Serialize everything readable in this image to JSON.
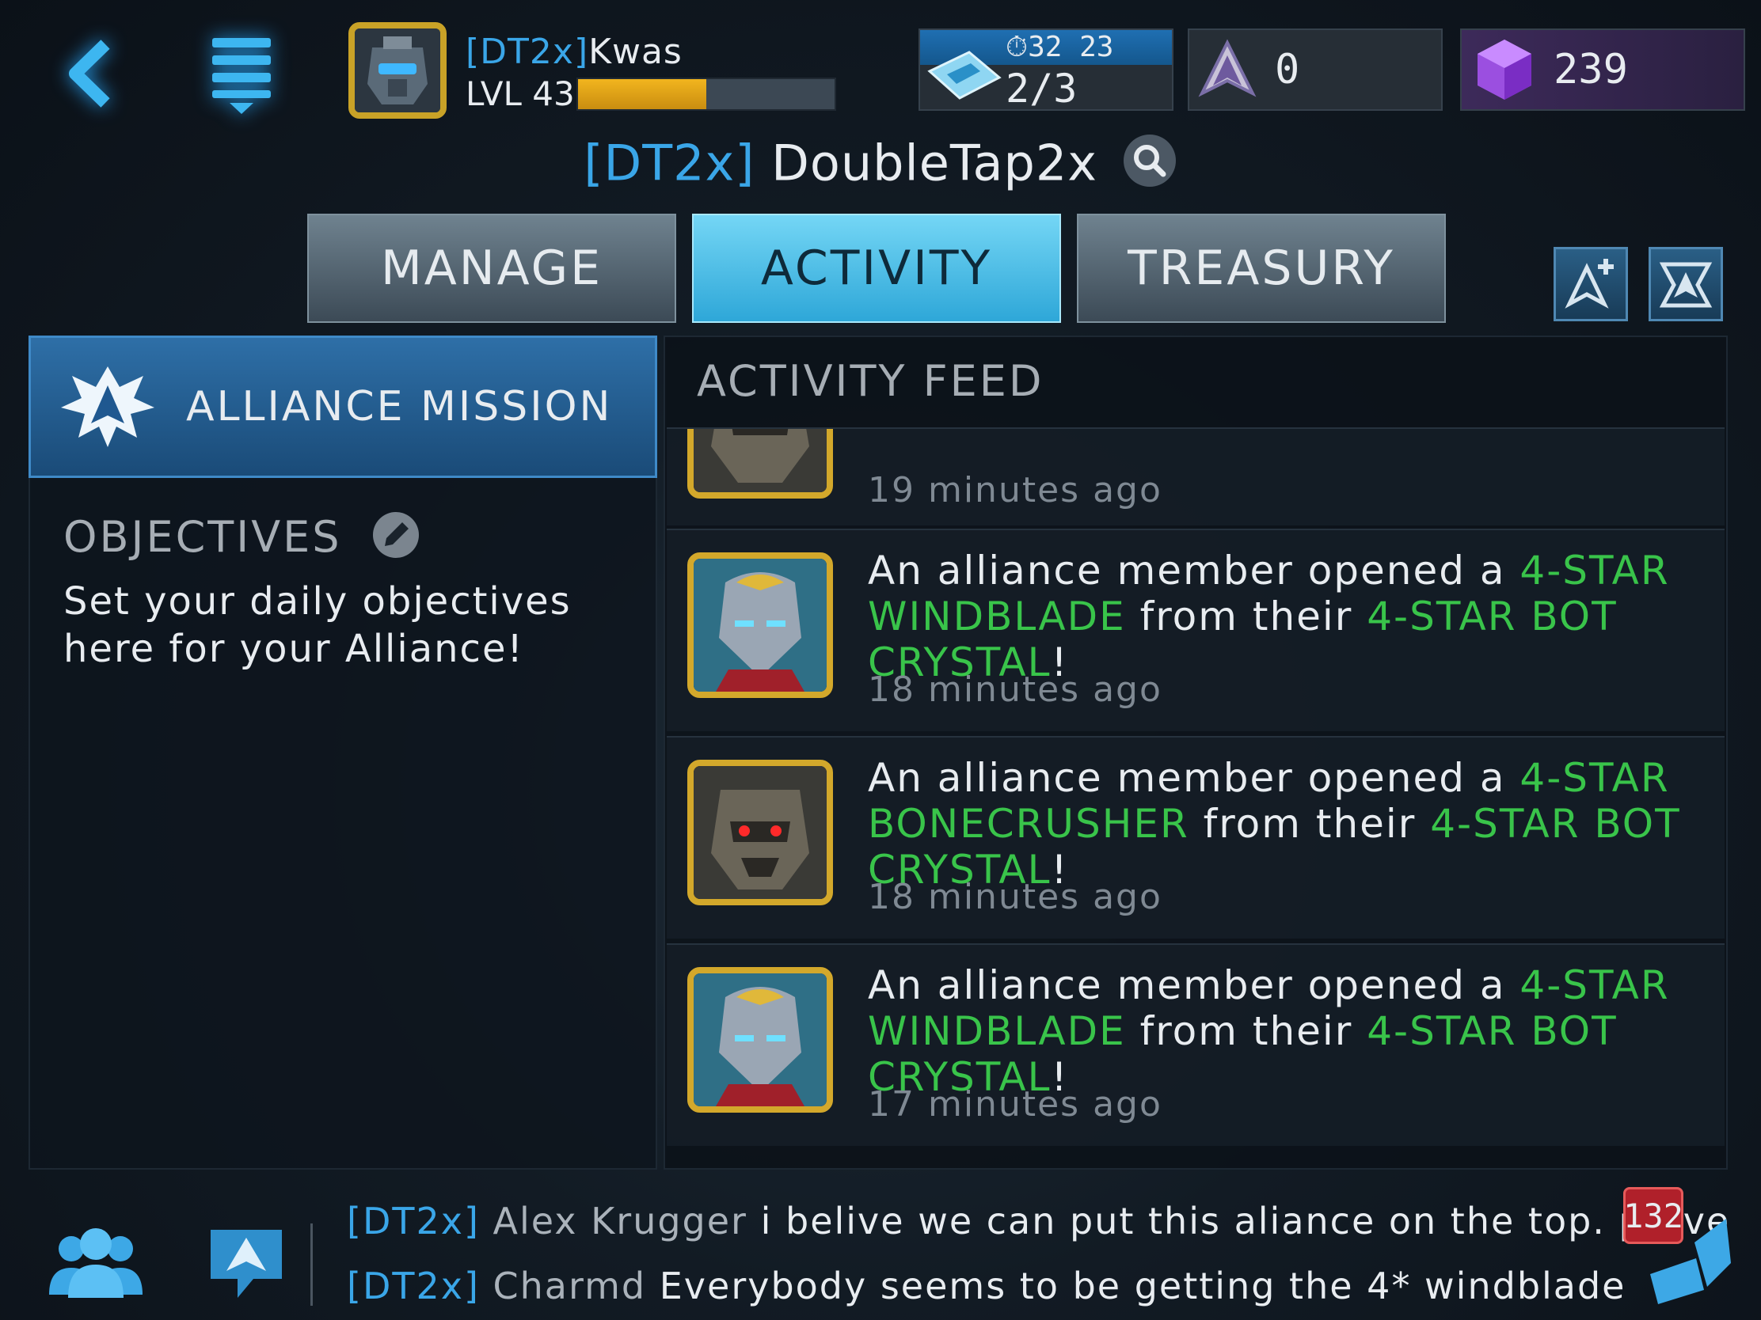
{
  "header": {
    "player_tag": "[DT2x]",
    "player_name": "Kwas",
    "level_label": "LVL 43",
    "xp_progress": 0.5,
    "energy_timer": "32 23",
    "energy_count": "2/3",
    "alliance_points": "0",
    "crystals": "239"
  },
  "alliance": {
    "tag": "[DT2x]",
    "name": "DoubleTap2x"
  },
  "tabs": [
    {
      "label": "MANAGE",
      "active": false
    },
    {
      "label": "ACTIVITY",
      "active": true
    },
    {
      "label": "TREASURY",
      "active": false
    }
  ],
  "mission": {
    "label": "ALLIANCE MISSION",
    "objectives_title": "OBJECTIVES",
    "objectives_text": "Set your daily objectives here for your Alliance!"
  },
  "feed": {
    "title": "ACTIVITY FEED",
    "items": [
      {
        "time": "19 minutes ago",
        "avatar": "bonecrusher"
      },
      {
        "prefix": "An alliance member opened a ",
        "bot": "4-STAR WINDBLADE",
        "middle": " from their ",
        "crystal": "4-STAR BOT CRYSTAL",
        "suffix": "!",
        "time": "18 minutes ago",
        "avatar": "windblade"
      },
      {
        "prefix": "An alliance member opened a ",
        "bot": "4-STAR BONECRUSHER",
        "middle": " from their ",
        "crystal": "4-STAR BOT CRYSTAL",
        "suffix": "!",
        "time": "18 minutes ago",
        "avatar": "bonecrusher"
      },
      {
        "prefix": "An alliance member opened a ",
        "bot": "4-STAR WINDBLADE",
        "middle": " from their ",
        "crystal": "4-STAR BOT CRYSTAL",
        "suffix": "!",
        "time": "17 minutes ago",
        "avatar": "windblade"
      }
    ]
  },
  "chat": {
    "messages": [
      {
        "tag": "[DT2x]",
        "name": "Alex Krugger",
        "text": " i belive we can put this aliance on the top. prove"
      },
      {
        "tag": "[DT2x]",
        "name": "Charmd",
        "text": " Everybody seems to be getting the 4* windblade"
      }
    ],
    "unread_count": "132"
  },
  "colors": {
    "accent_blue": "#3aa6e8",
    "highlight_green": "#39c44a",
    "gold_frame": "#d3a82b",
    "badge_red": "#b0202a"
  },
  "icons": [
    "back-icon",
    "menu-icon",
    "energy-card-icon",
    "alliance-points-icon",
    "crystal-icon",
    "search-icon",
    "add-alliance-icon",
    "alliance-emblem-icon",
    "mission-emblem-icon",
    "edit-icon",
    "members-icon",
    "alliance-chat-icon",
    "chat-toggle-icon"
  ]
}
